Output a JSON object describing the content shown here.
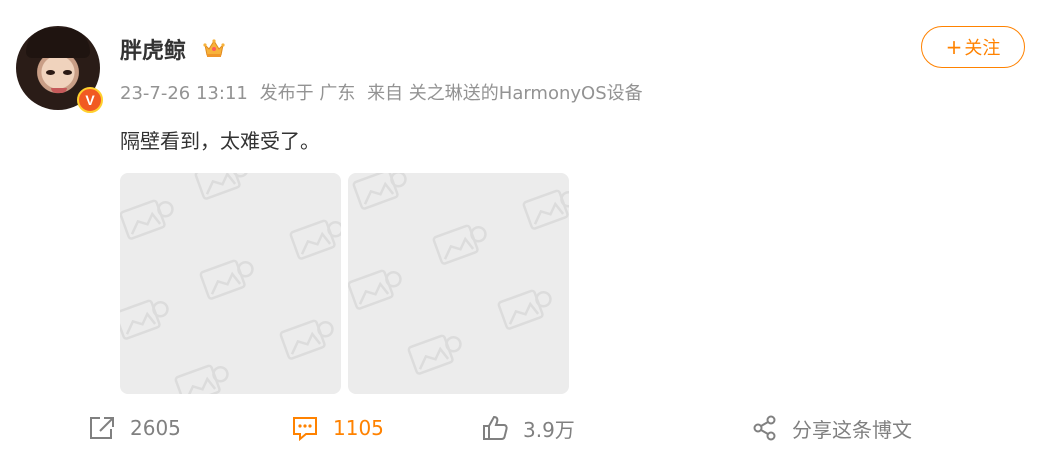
{
  "user": {
    "name": "胖虎鲸",
    "verified_badge": "V"
  },
  "follow_button": {
    "plus": "+",
    "label": "关注"
  },
  "meta": {
    "time": "23-7-26 13:11",
    "location": "发布于 广东",
    "source": "来自 关之琳送的HarmonyOS设备"
  },
  "post": {
    "text": "隔壁看到，太难受了。",
    "images": [
      "image-placeholder",
      "image-placeholder"
    ]
  },
  "actions": {
    "repost_count": "2605",
    "comment_count": "1105",
    "like_count": "3.9万",
    "share_label": "分享这条博文"
  },
  "colors": {
    "accent": "#ff8200",
    "meta_gray": "#939393",
    "placeholder_bg": "#ececec"
  }
}
